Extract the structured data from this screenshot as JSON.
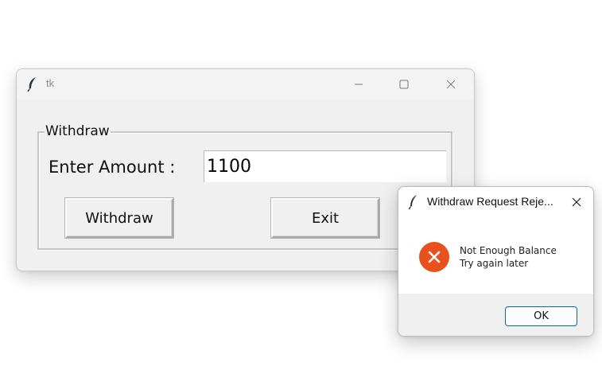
{
  "main_window": {
    "title": "tk",
    "frame_label": "Withdraw",
    "amount_label": "Enter Amount :",
    "amount_value": "1100",
    "withdraw_label": "Withdraw",
    "exit_label": "Exit"
  },
  "dialog": {
    "title": "Withdraw Request Reje...",
    "message_line1": "Not Enough Balance",
    "message_line2": "Try again later",
    "ok_label": "OK"
  },
  "colors": {
    "error_icon": "#e8501c",
    "ok_button_border": "#0067c0"
  },
  "icons": {
    "app_icon": "feather-icon",
    "minimize": "minimize-icon",
    "maximize": "maximize-icon",
    "close": "close-icon",
    "error": "error-x-icon"
  }
}
